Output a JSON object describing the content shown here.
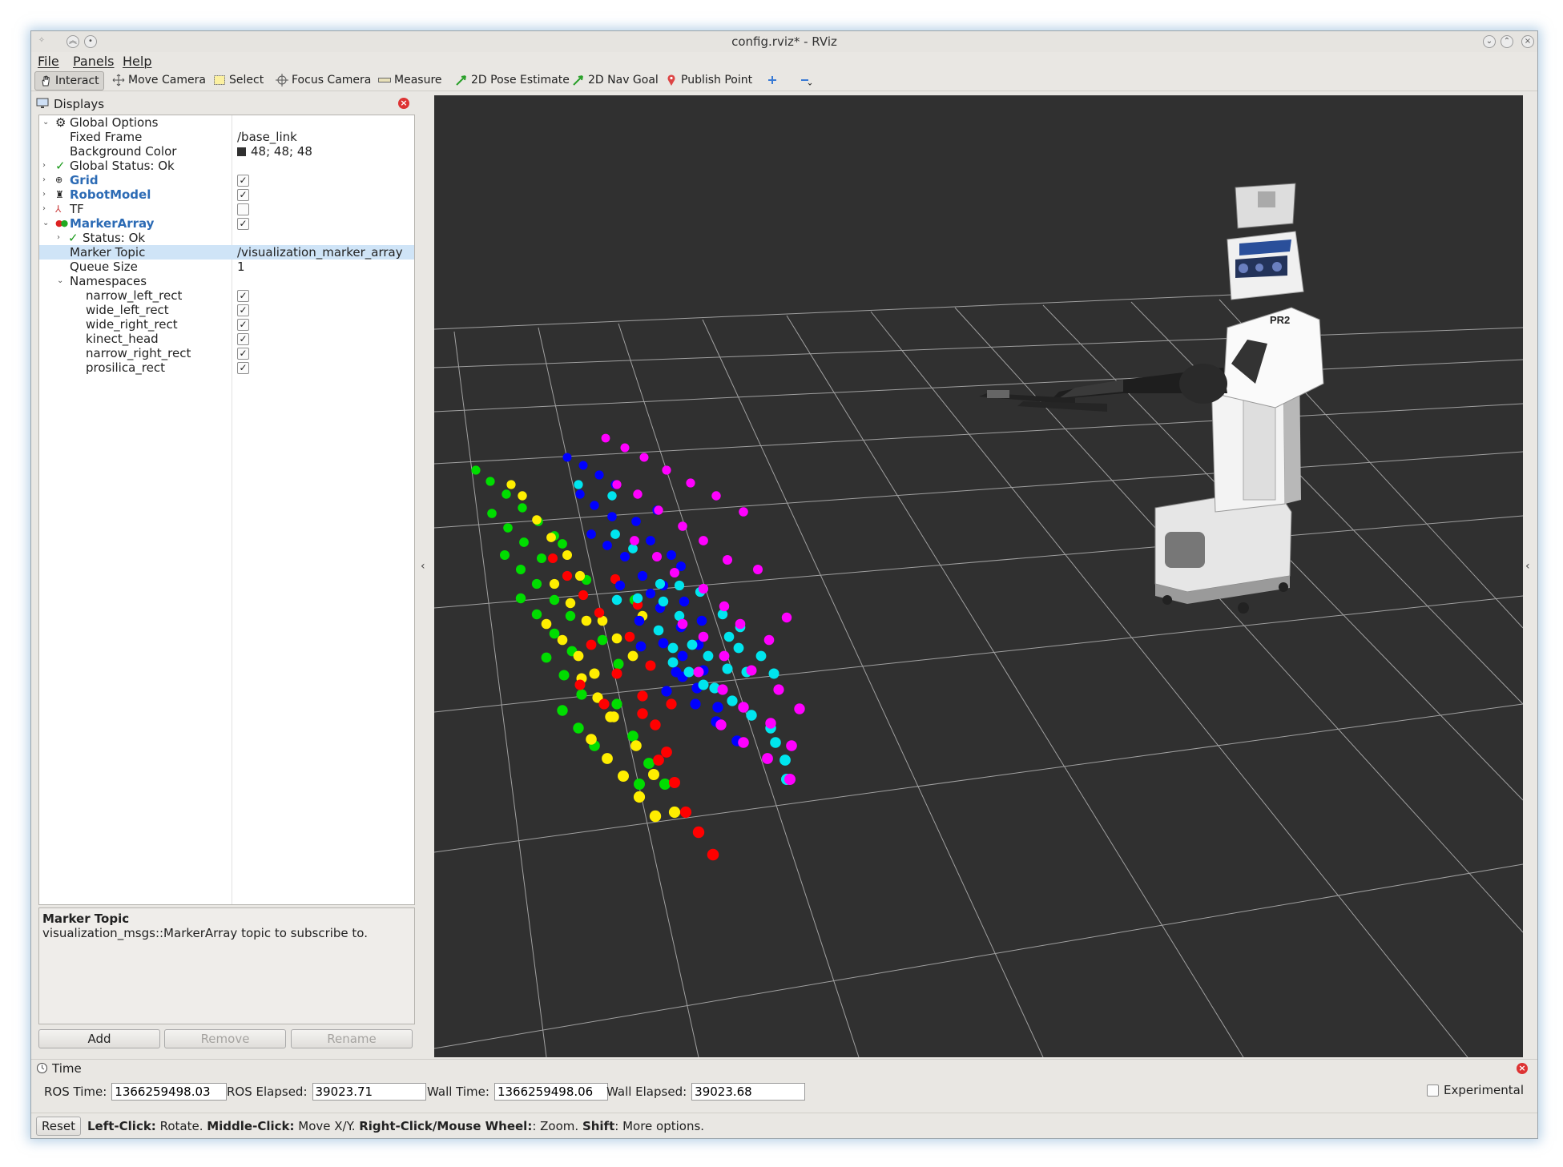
{
  "window": {
    "title": "config.rviz* - RViz"
  },
  "menu": [
    "File",
    "Panels",
    "Help"
  ],
  "toolbar": [
    {
      "label": "Interact",
      "icon": "hand-icon",
      "active": true
    },
    {
      "label": "Move Camera",
      "icon": "move-camera-icon"
    },
    {
      "label": "Select",
      "icon": "select-icon"
    },
    {
      "label": "Focus Camera",
      "icon": "focus-camera-icon"
    },
    {
      "label": "Measure",
      "icon": "ruler-icon"
    },
    {
      "label": "2D Pose Estimate",
      "icon": "pose-arrow-icon"
    },
    {
      "label": "2D Nav Goal",
      "icon": "nav-goal-arrow-icon"
    },
    {
      "label": "Publish Point",
      "icon": "map-pin-icon"
    }
  ],
  "displays": {
    "title": "Displays",
    "rows": [
      {
        "key": "Global Options"
      },
      {
        "key": "Fixed Frame",
        "value": "/base_link"
      },
      {
        "key": "Background Color",
        "value": "48; 48; 48"
      },
      {
        "key": "Global Status: Ok"
      },
      {
        "key": "Grid"
      },
      {
        "key": "RobotModel"
      },
      {
        "key": "TF"
      },
      {
        "key": "MarkerArray"
      },
      {
        "key": "Status: Ok"
      },
      {
        "key": "Marker Topic",
        "value": "/visualization_marker_array"
      },
      {
        "key": "Queue Size",
        "value": "1"
      },
      {
        "key": "Namespaces"
      },
      {
        "key": "narrow_left_rect"
      },
      {
        "key": "wide_left_rect"
      },
      {
        "key": "wide_right_rect"
      },
      {
        "key": "kinect_head"
      },
      {
        "key": "narrow_right_rect"
      },
      {
        "key": "prosilica_rect"
      }
    ],
    "help_title": "Marker Topic",
    "help_text": "visualization_msgs::MarkerArray topic to subscribe to.",
    "buttons": {
      "add": "Add",
      "remove": "Remove",
      "rename": "Rename"
    }
  },
  "view": {
    "background_color": "#303030",
    "marker_colors": [
      "#00dd00",
      "#ffee00",
      "#ff0000",
      "#0000ff",
      "#00e5ee",
      "#ff00ff"
    ],
    "robot_label": "PR2"
  },
  "time": {
    "title": "Time",
    "ros_time_label": "ROS Time:",
    "ros_time": "1366259498.03",
    "ros_elapsed_label": "ROS Elapsed:",
    "ros_elapsed": "39023.71",
    "wall_time_label": "Wall Time:",
    "wall_time": "1366259498.06",
    "wall_elapsed_label": "Wall Elapsed:",
    "wall_elapsed": "39023.68",
    "experimental": "Experimental"
  },
  "status": {
    "reset": "Reset",
    "h1": "Left-Click:",
    "t1": " Rotate. ",
    "h2": "Middle-Click:",
    "t2": " Move X/Y. ",
    "h3": "Right-Click/Mouse Wheel:",
    "t3": ": Zoom. ",
    "h4": "Shift",
    "t4": ": More options."
  }
}
